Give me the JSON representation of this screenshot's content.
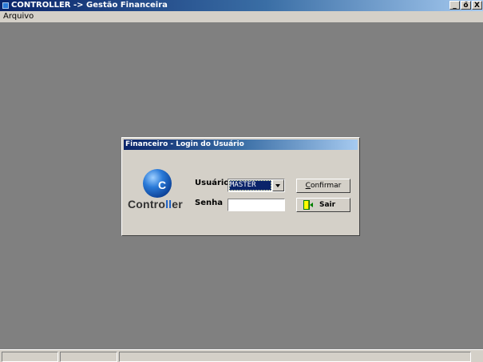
{
  "window": {
    "title": "CONTROLLER -> Gestão Financeira",
    "minimize_label": "_",
    "maximize_label": "ő",
    "close_label": "X"
  },
  "menu": {
    "items": [
      {
        "label": "Arquivo"
      }
    ]
  },
  "dialog": {
    "title": "Financeiro - Login do Usuário",
    "logo_text_prefix": "Contro",
    "logo_text_highlight": "ll",
    "logo_text_suffix": "er",
    "logo_ball_letter": "C",
    "user_label": "Usuário",
    "user_value": "MASTER",
    "password_label": "Senha",
    "password_value": "",
    "confirm_hotkey": "C",
    "confirm_rest": "onfirmar",
    "exit_label": "Sair"
  },
  "statusbar": {
    "panels": [
      "",
      "",
      ""
    ]
  },
  "colors": {
    "desktop": "#808080",
    "titlebar_start": "#0a246a",
    "titlebar_end": "#a6caf0",
    "face": "#d4d0c8",
    "logo_blue": "#1a5fc4"
  },
  "icons": [
    "app-icon",
    "logo-ball-icon",
    "dropdown-arrow-icon",
    "exit-door-icon"
  ]
}
